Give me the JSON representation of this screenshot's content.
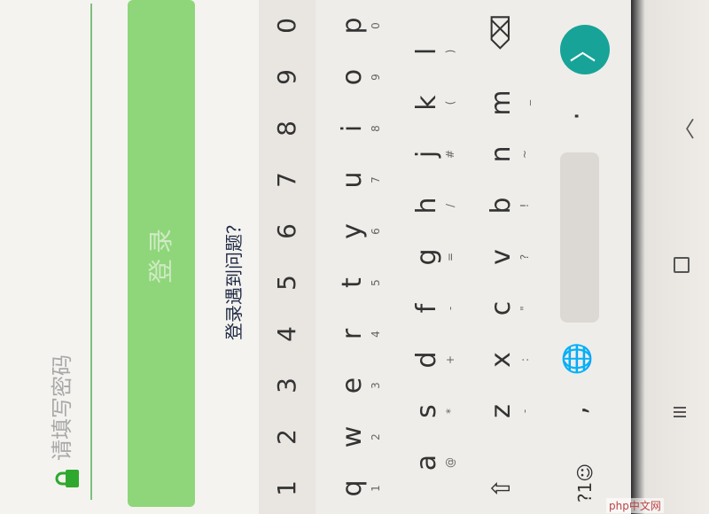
{
  "login": {
    "password_placeholder": "请填写密码",
    "login_button": "登录",
    "help_link": "登录遇到问题？"
  },
  "keyboard": {
    "number_row": [
      "1",
      "2",
      "3",
      "4",
      "5",
      "6",
      "7",
      "8",
      "9",
      "0"
    ],
    "row1": [
      {
        "key": "q",
        "sub": "1"
      },
      {
        "key": "w",
        "sub": "2"
      },
      {
        "key": "e",
        "sub": "3"
      },
      {
        "key": "r",
        "sub": "4"
      },
      {
        "key": "t",
        "sub": "5"
      },
      {
        "key": "y",
        "sub": "6"
      },
      {
        "key": "u",
        "sub": "7"
      },
      {
        "key": "i",
        "sub": "8"
      },
      {
        "key": "o",
        "sub": "9"
      },
      {
        "key": "p",
        "sub": "0"
      }
    ],
    "row2": [
      {
        "key": "a",
        "sub": "@"
      },
      {
        "key": "s",
        "sub": "*"
      },
      {
        "key": "d",
        "sub": "+"
      },
      {
        "key": "f",
        "sub": "-"
      },
      {
        "key": "g",
        "sub": "="
      },
      {
        "key": "h",
        "sub": "/"
      },
      {
        "key": "j",
        "sub": "#"
      },
      {
        "key": "k",
        "sub": "("
      },
      {
        "key": "l",
        "sub": ")"
      }
    ],
    "row3": [
      {
        "key": "z",
        "sub": "-"
      },
      {
        "key": "x",
        "sub": ":"
      },
      {
        "key": "c",
        "sub": "\""
      },
      {
        "key": "v",
        "sub": "?"
      },
      {
        "key": "b",
        "sub": "!"
      },
      {
        "key": "n",
        "sub": "~"
      },
      {
        "key": "m",
        "sub": "_"
      }
    ],
    "shift_glyph": "⇧",
    "backspace_glyph": "⌫",
    "symbols_label": "?1☺",
    "comma": ",",
    "globe_glyph": "🌐",
    "period": "·",
    "enter_glyph": "〉"
  },
  "navbar": {
    "back_glyph": "〈"
  },
  "watermark": "php中文网",
  "colors": {
    "accent_green": "#8fd67a",
    "input_line": "#7cc17a",
    "enter_teal": "#17a398"
  }
}
